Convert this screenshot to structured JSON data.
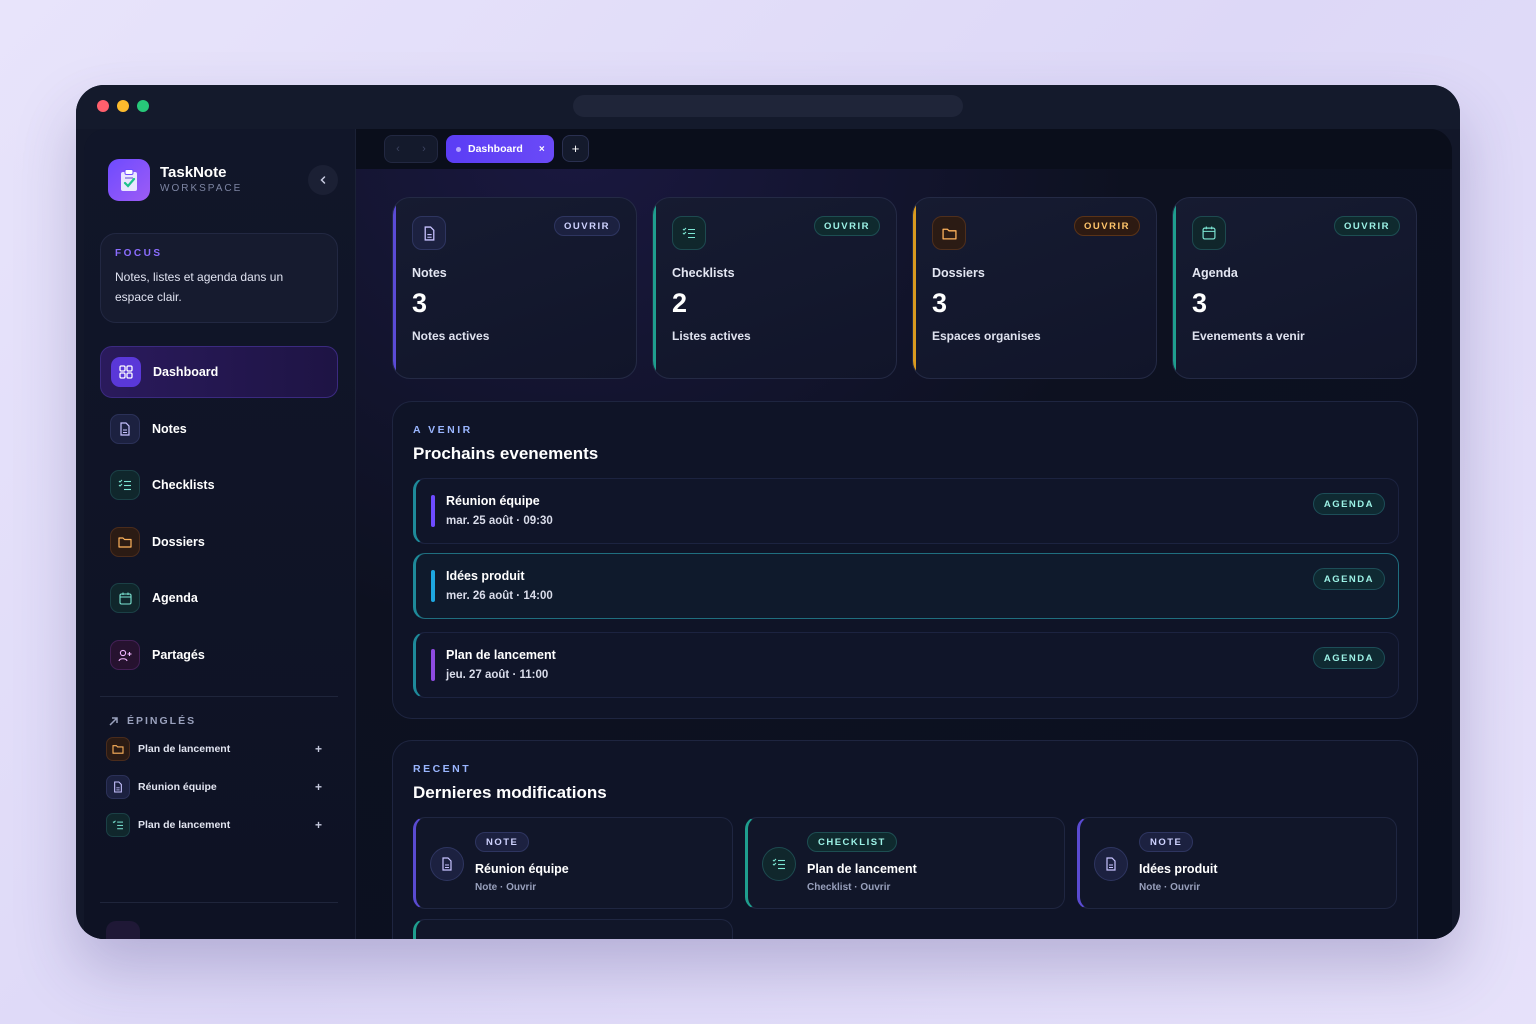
{
  "app": {
    "name": "TaskNote",
    "subtitle": "WORKSPACE"
  },
  "focus": {
    "title": "FOCUS",
    "text": "Notes, listes et agenda dans un espace clair."
  },
  "sidebar": {
    "items": [
      {
        "label": "Dashboard",
        "icon": "grid-icon"
      },
      {
        "label": "Notes",
        "icon": "document-icon"
      },
      {
        "label": "Checklists",
        "icon": "checklist-icon"
      },
      {
        "label": "Dossiers",
        "icon": "folder-icon"
      },
      {
        "label": "Agenda",
        "icon": "calendar-icon"
      },
      {
        "label": "Partagés",
        "icon": "user-plus-icon"
      }
    ],
    "pinned_title": "ÉPINGLÉS",
    "pinned": [
      {
        "label": "Plan de lancement",
        "icon": "folder-icon"
      },
      {
        "label": "Réunion équipe",
        "icon": "document-icon"
      },
      {
        "label": "Plan de lancement",
        "icon": "checklist-icon"
      }
    ]
  },
  "tabs": {
    "active": "Dashboard",
    "close": "×",
    "add": "+"
  },
  "stats": [
    {
      "label": "Notes",
      "value": "3",
      "sub": "Notes actives",
      "action": "OUVRIR",
      "accent": "#5b4bd6"
    },
    {
      "label": "Checklists",
      "value": "2",
      "sub": "Listes actives",
      "action": "OUVRIR",
      "accent": "#1f9e8e"
    },
    {
      "label": "Dossiers",
      "value": "3",
      "sub": "Espaces organises",
      "action": "OUVRIR",
      "accent": "#d99a1f"
    },
    {
      "label": "Agenda",
      "value": "3",
      "sub": "Evenements a venir",
      "action": "OUVRIR",
      "accent": "#1f9e8e"
    }
  ],
  "upcoming": {
    "kicker": "A VENIR",
    "title": "Prochains evenements",
    "events": [
      {
        "title": "Réunion équipe",
        "date": "mar. 25 août · 09:30",
        "badge": "AGENDA",
        "color": "#6e4bff"
      },
      {
        "title": "Idées produit",
        "date": "mer. 26 août · 14:00",
        "badge": "AGENDA",
        "color": "#1ea7e0"
      },
      {
        "title": "Plan de lancement",
        "date": "jeu. 27 août · 11:00",
        "badge": "AGENDA",
        "color": "#8e4be0"
      }
    ]
  },
  "recent": {
    "kicker": "RECENT",
    "title": "Dernieres modifications",
    "items": [
      {
        "badge": "NOTE",
        "title": "Réunion équipe",
        "sub": "Note · Ouvrir",
        "icon": "document-icon"
      },
      {
        "badge": "CHECKLIST",
        "title": "Plan de lancement",
        "sub": "Checklist · Ouvrir",
        "icon": "checklist-icon"
      },
      {
        "badge": "NOTE",
        "title": "Idées produit",
        "sub": "Note · Ouvrir",
        "icon": "document-icon"
      }
    ]
  },
  "colors": {
    "accent": "#6a4af7",
    "teal": "#1f9e8e",
    "amber": "#d99a1f",
    "background": "#0c1020"
  }
}
